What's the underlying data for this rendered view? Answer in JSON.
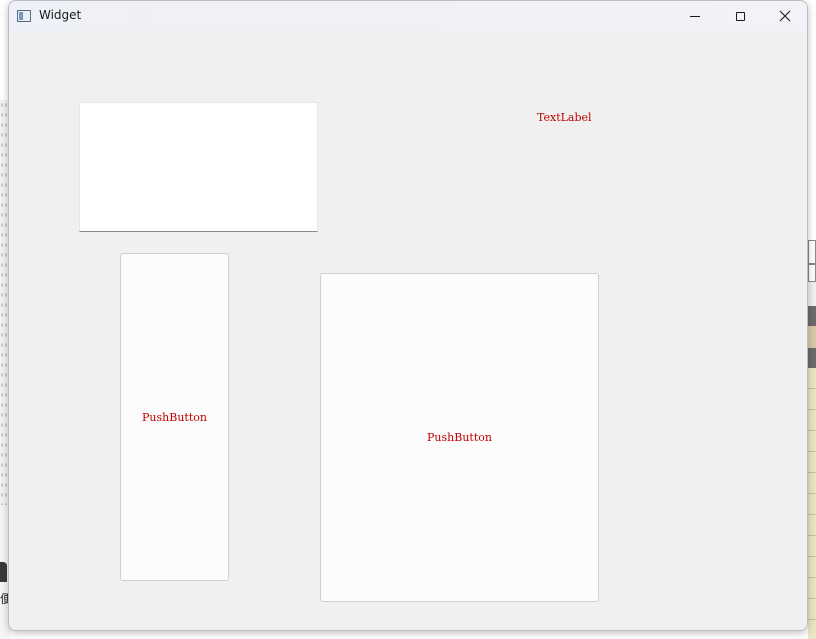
{
  "window": {
    "title": "Widget",
    "controls": {
      "minimize_icon": "minimize-icon",
      "maximize_icon": "maximize-icon",
      "close_glyph": "✕"
    }
  },
  "content": {
    "text_label": "TextLabel",
    "push_button_1": "PushButton",
    "push_button_2": "PushButton",
    "text_edit_value": ""
  },
  "background": {
    "left_char": "便"
  },
  "colors": {
    "label_text": "#c00000",
    "window_bg": "#f0f0f0"
  }
}
